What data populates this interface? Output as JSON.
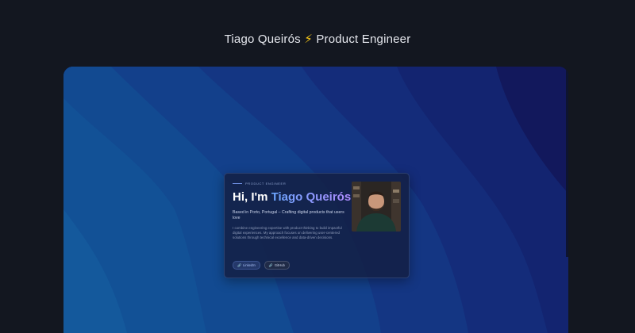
{
  "page": {
    "title_name": "Tiago Queirós",
    "title_bolt": "⚡",
    "title_role": "Product Engineer"
  },
  "card": {
    "eyebrow": "Product Engineer",
    "greeting": "Hi, I'm",
    "name": "Tiago Queirós",
    "tagline": "Based in Porto, Portugal – Crafting digital products that users love",
    "bio": "I combine engineering expertise with product thinking to build impactful digital experiences. My approach focuses on delivering user-centered solutions through technical excellence and data-driven decisions.",
    "links": [
      {
        "label": "LinkedIn",
        "icon": "link-icon"
      },
      {
        "label": "GitHub",
        "icon": "link-icon"
      }
    ]
  },
  "colors": {
    "background": "#131720",
    "accent_start": "#6aa6ff",
    "accent_end": "#b08cff",
    "bolt": "#f5c518"
  }
}
